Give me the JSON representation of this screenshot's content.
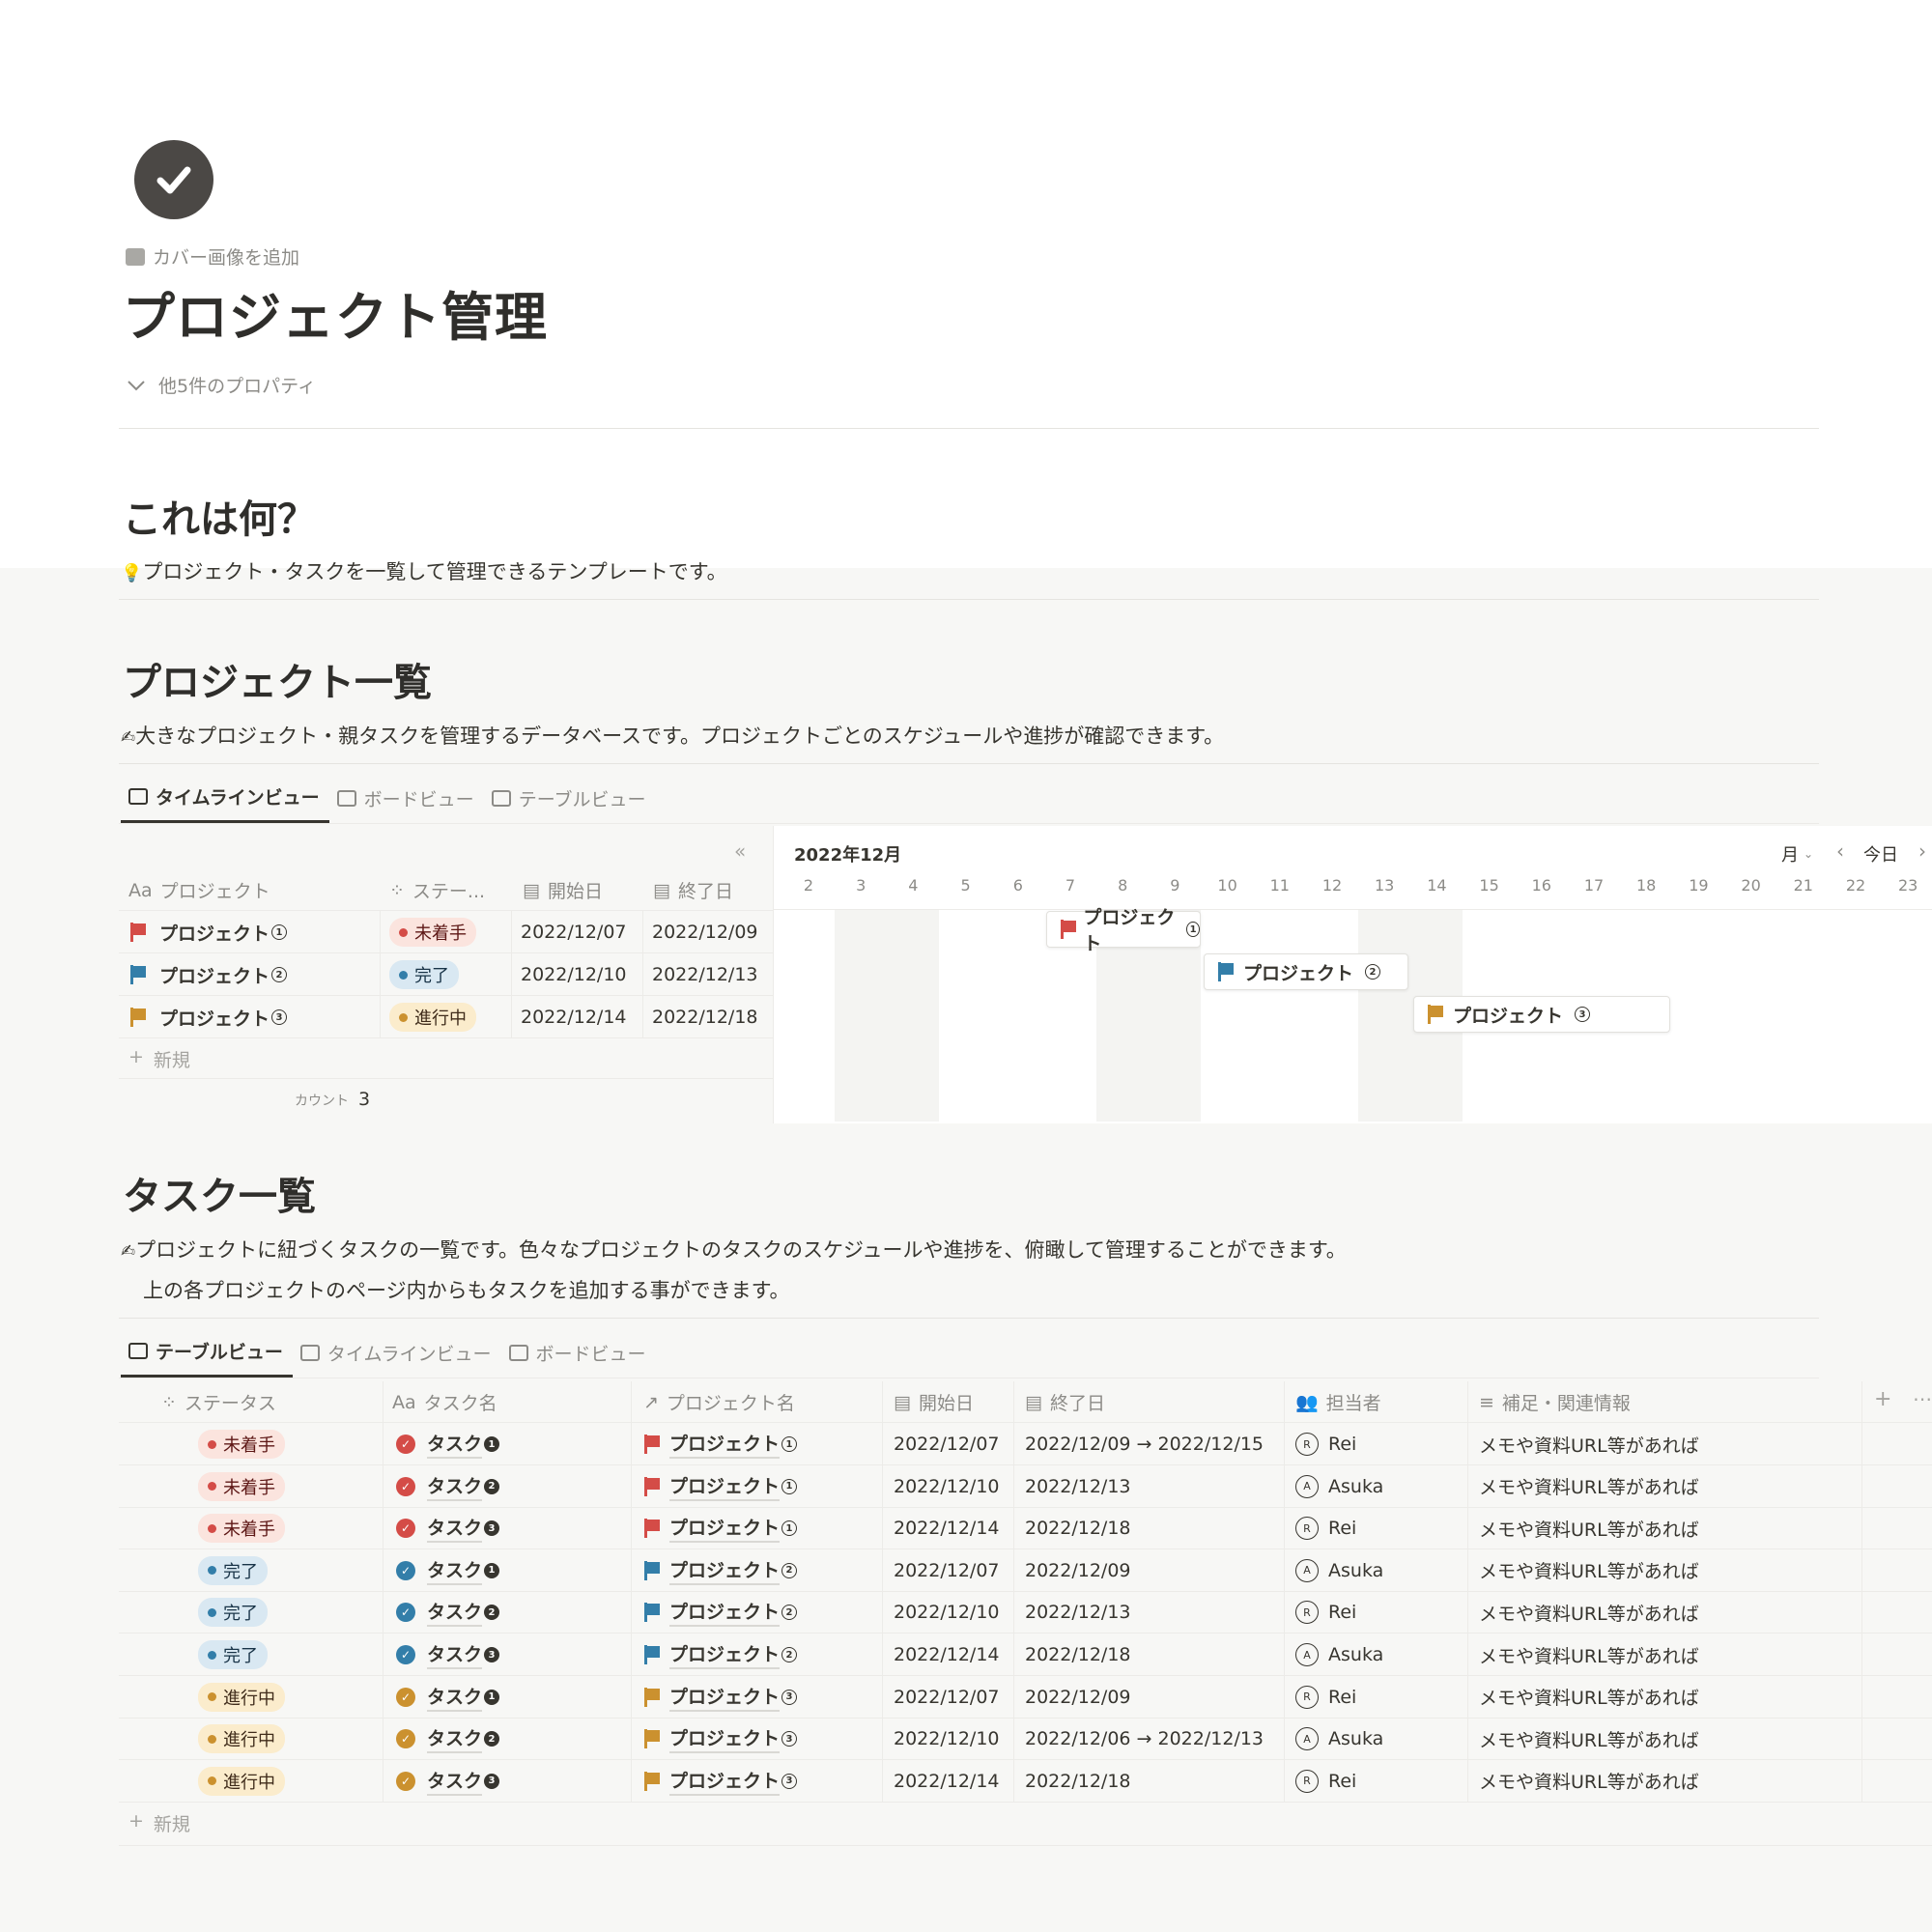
{
  "page": {
    "cover_label": "カバー画像を追加",
    "title": "プロジェクト管理",
    "props_toggle": "他5件のプロパティ"
  },
  "about": {
    "heading": "これは何？",
    "text": "プロジェクト・タスクを一覧して管理できるテンプレートです。"
  },
  "projects": {
    "heading": "プロジェクト一覧",
    "text": "大きなプロジェクト・親タスクを管理するデータベースです。プロジェクトごとのスケジュールや進捗が確認できます。",
    "tabs": [
      "タイムラインビュー",
      "ボードビュー",
      "テーブルビュー"
    ],
    "columns": {
      "name": "プロジェクト",
      "status": "ステー...",
      "start": "開始日",
      "end": "終了日"
    },
    "rows": [
      {
        "name": "プロジェクト",
        "num": "1",
        "status": "未着手",
        "start": "2022/12/07",
        "end": "2022/12/09",
        "color": "#d44c47"
      },
      {
        "name": "プロジェクト",
        "num": "2",
        "status": "完了",
        "start": "2022/12/10",
        "end": "2022/12/13",
        "color": "#337ea9"
      },
      {
        "name": "プロジェクト",
        "num": "3",
        "status": "進行中",
        "start": "2022/12/14",
        "end": "2022/12/18",
        "color": "#cb912f"
      }
    ],
    "new_label": "新規",
    "count_label": "カウント",
    "count_value": "3",
    "timeline": {
      "month": "2022年12月",
      "scale": "月",
      "today": "今日",
      "days": [
        "2",
        "3",
        "4",
        "5",
        "6",
        "7",
        "8",
        "9",
        "10",
        "11",
        "12",
        "13",
        "14",
        "15",
        "16",
        "17",
        "18",
        "19",
        "20",
        "21",
        "22",
        "23"
      ]
    }
  },
  "tasks": {
    "heading": "タスク一覧",
    "text1": "プロジェクトに紐づくタスクの一覧です。色々なプロジェクトのタスクのスケジュールや進捗を、俯瞰して管理することができます。",
    "text2": "上の各プロジェクトのページ内からもタスクを追加する事ができます。",
    "tabs": [
      "テーブルビュー",
      "タイムラインビュー",
      "ボードビュー"
    ],
    "columns": {
      "status": "ステータス",
      "name": "タスク名",
      "project": "プロジェクト名",
      "start": "開始日",
      "end": "終了日",
      "assignee": "担当者",
      "notes": "補足・関連情報"
    },
    "rows": [
      {
        "status": "未着手",
        "task": "タスク",
        "tnum": "1",
        "project": "プロジェクト",
        "pnum": "1",
        "start": "2022/12/07",
        "end": "2022/12/09 → 2022/12/15",
        "assignee": "Rei",
        "initial": "R",
        "notes": "メモや資料URL等があれば",
        "color": "#d44c47"
      },
      {
        "status": "未着手",
        "task": "タスク",
        "tnum": "2",
        "project": "プロジェクト",
        "pnum": "1",
        "start": "2022/12/10",
        "end": "2022/12/13",
        "assignee": "Asuka",
        "initial": "A",
        "notes": "メモや資料URL等があれば",
        "color": "#d44c47"
      },
      {
        "status": "未着手",
        "task": "タスク",
        "tnum": "3",
        "project": "プロジェクト",
        "pnum": "1",
        "start": "2022/12/14",
        "end": "2022/12/18",
        "assignee": "Rei",
        "initial": "R",
        "notes": "メモや資料URL等があれば",
        "color": "#d44c47"
      },
      {
        "status": "完了",
        "task": "タスク",
        "tnum": "1",
        "project": "プロジェクト",
        "pnum": "2",
        "start": "2022/12/07",
        "end": "2022/12/09",
        "assignee": "Asuka",
        "initial": "A",
        "notes": "メモや資料URL等があれば",
        "color": "#337ea9"
      },
      {
        "status": "完了",
        "task": "タスク",
        "tnum": "2",
        "project": "プロジェクト",
        "pnum": "2",
        "start": "2022/12/10",
        "end": "2022/12/13",
        "assignee": "Rei",
        "initial": "R",
        "notes": "メモや資料URL等があれば",
        "color": "#337ea9"
      },
      {
        "status": "完了",
        "task": "タスク",
        "tnum": "3",
        "project": "プロジェクト",
        "pnum": "2",
        "start": "2022/12/14",
        "end": "2022/12/18",
        "assignee": "Asuka",
        "initial": "A",
        "notes": "メモや資料URL等があれば",
        "color": "#337ea9"
      },
      {
        "status": "進行中",
        "task": "タスク",
        "tnum": "1",
        "project": "プロジェクト",
        "pnum": "3",
        "start": "2022/12/07",
        "end": "2022/12/09",
        "assignee": "Rei",
        "initial": "R",
        "notes": "メモや資料URL等があれば",
        "color": "#cb912f"
      },
      {
        "status": "進行中",
        "task": "タスク",
        "tnum": "2",
        "project": "プロジェクト",
        "pnum": "3",
        "start": "2022/12/10",
        "end": "2022/12/06 → 2022/12/13",
        "assignee": "Asuka",
        "initial": "A",
        "notes": "メモや資料URL等があれば",
        "color": "#cb912f"
      },
      {
        "status": "進行中",
        "task": "タスク",
        "tnum": "3",
        "project": "プロジェクト",
        "pnum": "3",
        "start": "2022/12/14",
        "end": "2022/12/18",
        "assignee": "Rei",
        "initial": "R",
        "notes": "メモや資料URL等があれば",
        "color": "#cb912f"
      }
    ],
    "new_label": "新規"
  }
}
